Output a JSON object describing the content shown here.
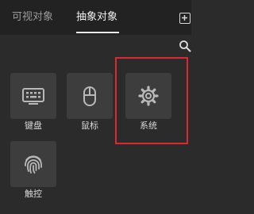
{
  "tabs": [
    {
      "label": "可视对象",
      "active": false
    },
    {
      "label": "抽象对象",
      "active": true
    }
  ],
  "items": [
    {
      "label": "键盘",
      "icon": "keyboard-icon"
    },
    {
      "label": "鼠标",
      "icon": "mouse-icon"
    },
    {
      "label": "系统",
      "icon": "gear-icon",
      "highlighted": true
    },
    {
      "label": "触控",
      "icon": "fingerprint-icon"
    }
  ],
  "colors": {
    "background": "#2b2b2b",
    "tabbar": "#222222",
    "tile": "#3d3d3d",
    "highlight": "#e0262e"
  }
}
